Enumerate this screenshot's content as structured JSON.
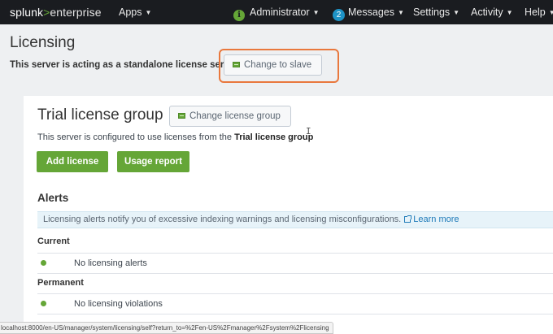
{
  "topbar": {
    "logo_brand": "splunk",
    "logo_sep": ">",
    "logo_product": "enterprise",
    "apps": "Apps",
    "info_icon": "i",
    "administrator": "Administrator",
    "messages_count": "2",
    "messages": "Messages",
    "settings": "Settings",
    "activity": "Activity",
    "help": "Help"
  },
  "page": {
    "title": "Licensing",
    "subtitle": "This server is acting as a standalone license server",
    "change_button": "Change to slave"
  },
  "group": {
    "title": "Trial license group",
    "change_button": "Change license group",
    "desc_prefix": "This server is configured to use licenses from the ",
    "desc_group": "Trial license group",
    "add_license": "Add license",
    "usage_report": "Usage report"
  },
  "alerts": {
    "title": "Alerts",
    "info": "Licensing alerts notify you of excessive indexing warnings and licensing misconfigurations.",
    "learn_more": "Learn more",
    "current_label": "Current",
    "current_text": "No licensing alerts",
    "permanent_label": "Permanent",
    "permanent_text": "No licensing violations"
  },
  "statusbar": {
    "url": "localhost:8000/en-US/manager/system/licensing/self?return_to=%2Fen-US%2Fmanager%2Fsystem%2Flicensing"
  },
  "colors": {
    "accent_green": "#65a637",
    "highlight_orange": "#e9783d",
    "badge_blue": "#1e93c6",
    "topbar_bg": "#1a1c20"
  },
  "icons": [
    "info-icon",
    "license-icon",
    "external-link-icon",
    "status-ok-icon",
    "text-cursor-icon",
    "chevron-down-icon"
  ]
}
